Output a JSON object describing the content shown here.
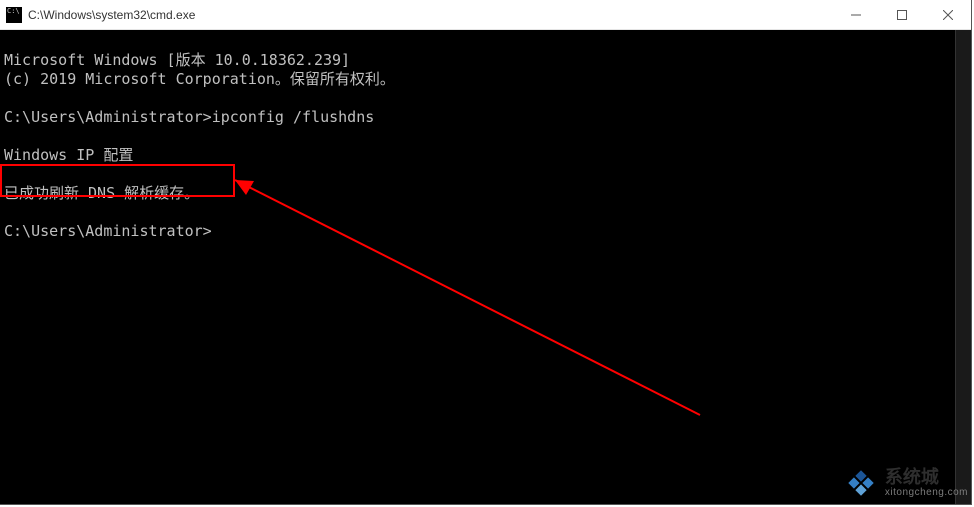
{
  "window": {
    "title": "C:\\Windows\\system32\\cmd.exe"
  },
  "terminal": {
    "line1": "Microsoft Windows [版本 10.0.18362.239]",
    "line2": "(c) 2019 Microsoft Corporation。保留所有权利。",
    "blank1": "",
    "prompt1_path": "C:\\Users\\Administrator>",
    "prompt1_cmd": "ipconfig /flushdns",
    "blank2": "",
    "cfg_header": "Windows IP 配置",
    "blank3": "",
    "success_msg": "已成功刷新 DNS 解析缓存。",
    "blank4": "",
    "prompt2_path": "C:\\Users\\Administrator>"
  },
  "annotation": {
    "highlight_target": "success_msg"
  },
  "watermark": {
    "brand": "系统城",
    "url": "xitongcheng.com"
  }
}
